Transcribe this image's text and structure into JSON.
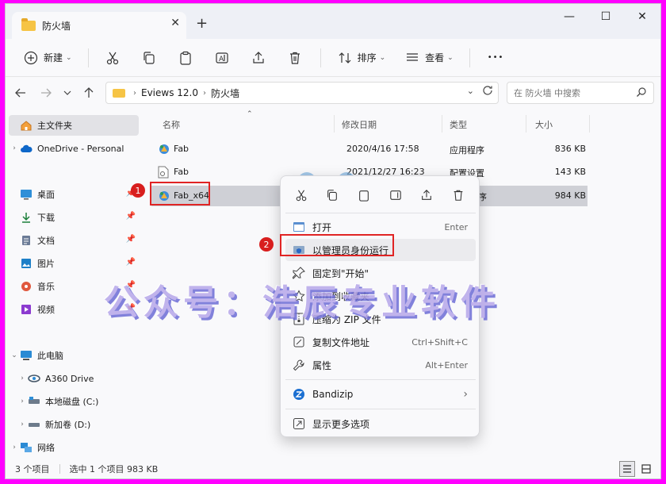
{
  "tab": {
    "title": "防火墙",
    "close": "✕",
    "new": "+"
  },
  "window_controls": {
    "minimize": "—",
    "maximize": "☐",
    "close": "✕"
  },
  "toolbar": {
    "new_label": "新建",
    "sort_label": "排序",
    "view_label": "查看",
    "more": "•••"
  },
  "address": {
    "crumbs": [
      "Eviews 12.0",
      "防火墙"
    ],
    "separator": "›"
  },
  "search": {
    "placeholder": "在 防火墙 中搜索"
  },
  "sidebar": {
    "items": [
      {
        "label": "主文件夹",
        "icon": "home-icon"
      },
      {
        "label": "OneDrive - Personal",
        "icon": "cloud-icon"
      },
      {
        "label": "桌面",
        "icon": "desktop-icon"
      },
      {
        "label": "下载",
        "icon": "download-icon"
      },
      {
        "label": "文档",
        "icon": "document-icon"
      },
      {
        "label": "图片",
        "icon": "picture-icon"
      },
      {
        "label": "音乐",
        "icon": "music-icon"
      },
      {
        "label": "视频",
        "icon": "video-icon"
      },
      {
        "label": "此电脑",
        "icon": "pc-icon"
      },
      {
        "label": "A360 Drive",
        "icon": "a360-icon"
      },
      {
        "label": "本地磁盘 (C:)",
        "icon": "drive-icon"
      },
      {
        "label": "新加卷 (D:)",
        "icon": "drive-icon"
      },
      {
        "label": "网络",
        "icon": "network-icon"
      }
    ]
  },
  "columns": {
    "name": "名称",
    "date": "修改日期",
    "type": "类型",
    "size": "大小"
  },
  "files": [
    {
      "name": "Fab",
      "date": "2020/4/16 17:58",
      "type": "应用程序",
      "size": "836 KB"
    },
    {
      "name": "Fab",
      "date": "2021/12/27 16:23",
      "type": "配置设置",
      "size": "143 KB"
    },
    {
      "name": "Fab_x64",
      "date": "",
      "type": "序",
      "size": "984 KB"
    }
  ],
  "context_menu": {
    "items": [
      {
        "label": "打开",
        "shortcut": "Enter"
      },
      {
        "label": "以管理员身份运行",
        "shortcut": ""
      },
      {
        "label": "固定到\"开始\"",
        "shortcut": ""
      },
      {
        "label": "添加到收藏夹",
        "shortcut": ""
      },
      {
        "label": "压缩为 ZIP 文件",
        "shortcut": ""
      },
      {
        "label": "复制文件地址",
        "shortcut": "Ctrl+Shift+C"
      },
      {
        "label": "属性",
        "shortcut": "Alt+Enter"
      },
      {
        "label": "Bandizip",
        "shortcut": "›"
      },
      {
        "label": "显示更多选项",
        "shortcut": ""
      }
    ]
  },
  "annotations": {
    "step1": "1",
    "step2": "2"
  },
  "watermark": "公众号：浩辰专业软件",
  "status": {
    "count": "3 个项目",
    "selected": "选中 1 个项目  983 KB"
  },
  "colors": {
    "accent": "#0067c0",
    "annotation": "#e02424",
    "background": "#ff00ff"
  }
}
